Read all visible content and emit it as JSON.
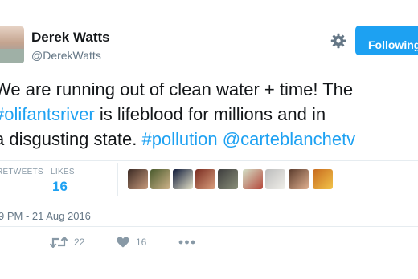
{
  "tweet": {
    "author": {
      "display_name": "Derek Watts",
      "handle": "@DerekWatts"
    },
    "follow_button_label": "Following",
    "text_lines": [
      [
        {
          "text": "We are running out of clean water + time! The ",
          "kind": "plain"
        }
      ],
      [
        {
          "text": "#olifantsriver",
          "kind": "link"
        },
        {
          "text": " is lifeblood for millions and in",
          "kind": "plain"
        }
      ],
      [
        {
          "text": "a disgusting state. ",
          "kind": "plain"
        },
        {
          "text": "#pollution",
          "kind": "link"
        },
        {
          "text": " ",
          "kind": "plain"
        },
        {
          "text": "@carteblanchetv",
          "kind": "link"
        }
      ]
    ],
    "stats": {
      "retweets_label": "RETWEETS",
      "likes_label": "LIKES",
      "likes_value": "16"
    },
    "likers": [
      {
        "name": "liker-1",
        "colors": [
          "#3b2a24",
          "#c79a7c"
        ]
      },
      {
        "name": "liker-2",
        "colors": [
          "#4a5b2e",
          "#d0b48a"
        ]
      },
      {
        "name": "liker-3",
        "colors": [
          "#0e1a3a",
          "#e6e2c8"
        ]
      },
      {
        "name": "liker-4",
        "colors": [
          "#7a2d22",
          "#dba07e"
        ]
      },
      {
        "name": "liker-5",
        "colors": [
          "#3d3d3d",
          "#8a8f7a"
        ]
      },
      {
        "name": "liker-6",
        "colors": [
          "#d4e0c8",
          "#b5473a"
        ]
      },
      {
        "name": "liker-7",
        "colors": [
          "#bdbdbd",
          "#f0efe9"
        ]
      },
      {
        "name": "liker-8",
        "colors": [
          "#5a3b2c",
          "#e0b090"
        ]
      },
      {
        "name": "liker-9",
        "colors": [
          "#c76a1e",
          "#f2c44a"
        ]
      }
    ],
    "timestamp": "9 PM - 21 Aug 2016",
    "actions": {
      "retweet_count": "22",
      "like_count": "16"
    },
    "colors": {
      "accent": "#1da1f2",
      "text": "#14171a",
      "muted": "#657786",
      "divider": "#e6ecf0"
    }
  }
}
